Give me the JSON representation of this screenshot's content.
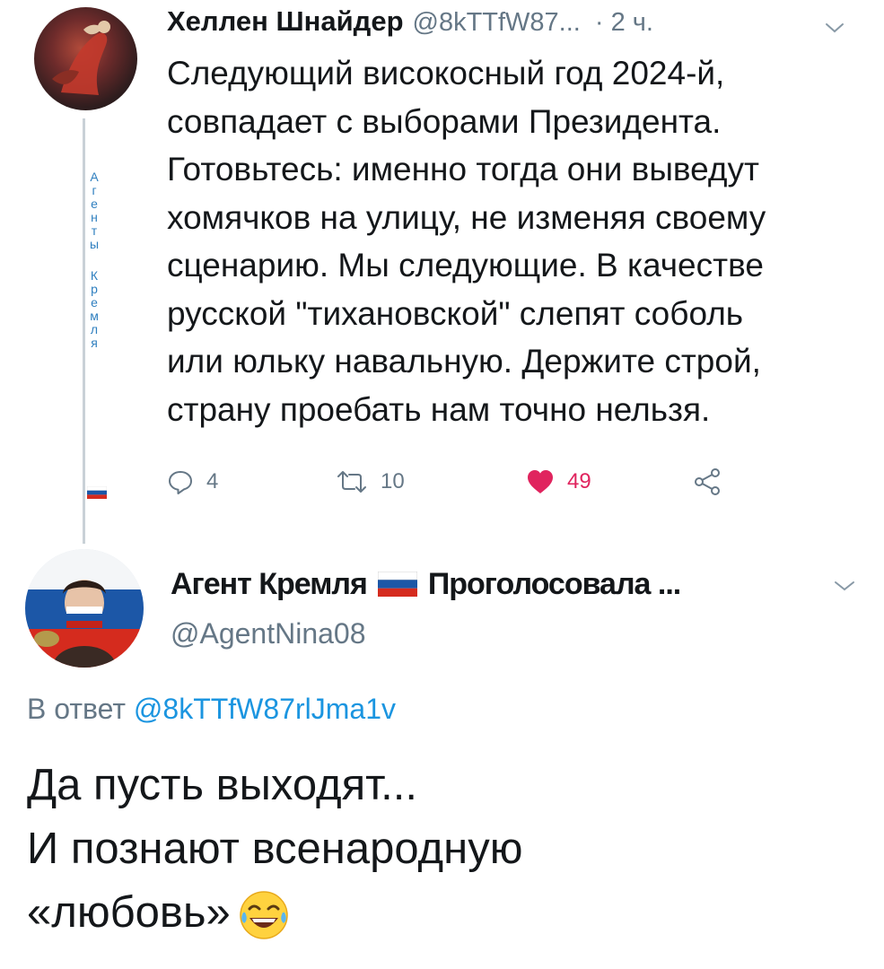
{
  "tweet1": {
    "author_name": "Хеллен Шнайдер",
    "author_handle": "@8kTTfW87...",
    "time": "· 2 ч.",
    "thread_vertical_label": [
      "А",
      "г",
      "е",
      "н",
      "т",
      "ы",
      "",
      "К",
      "р",
      "е",
      "м",
      "л",
      "я"
    ],
    "text": "Следующий високосный год 2024-й,\nсовпадает с выборами Президента.\nГотовьтесь: именно тогда они выведут\nхомячков на улицу, не изменяя своему\nсценарию. Мы следующие. В качестве\nрусской \"тихановской\" слепят соболь\nили юльку навальную. Держите строй,\nстрану проебать нам точно нельзя.",
    "stats": {
      "replies": "4",
      "retweets": "10",
      "likes": "49"
    }
  },
  "tweet2": {
    "author_name_part1": "Агент Кремля",
    "author_name_part2": "Проголосовала ...",
    "author_handle": "@AgentNina08",
    "reply_label": "В ответ",
    "reply_mention": "@8kTTfW87rlJma1v",
    "text": "Да пусть выходят...\nИ познают всенародную\n«любовь»"
  },
  "icons": {
    "reply": "reply-icon",
    "retweet": "retweet-icon",
    "like": "heart-icon",
    "share": "share-icon",
    "menu": "chevron-down-icon",
    "flag": "russia-flag-icon",
    "emoji": "laughing-tears-emoji-icon"
  },
  "colors": {
    "text": "#14171a",
    "secondary": "#657786",
    "link": "#1b95e0",
    "like": "#e0245e",
    "thread_line": "#c9d1d7"
  }
}
